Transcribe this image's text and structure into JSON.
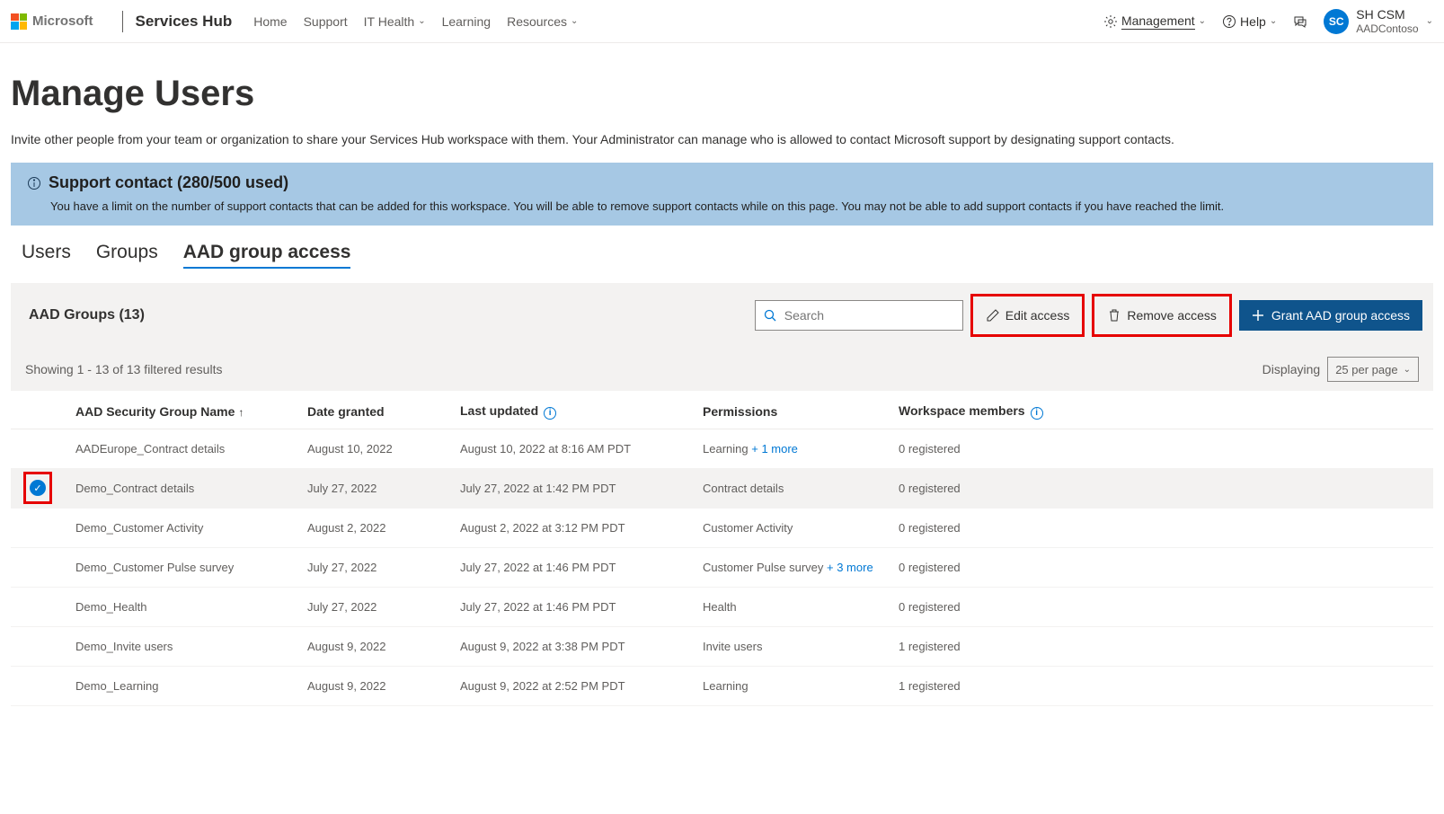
{
  "header": {
    "microsoft": "Microsoft",
    "brand": "Services Hub",
    "nav": [
      "Home",
      "Support",
      "IT Health",
      "Learning",
      "Resources"
    ],
    "management": "Management",
    "help": "Help",
    "user_initials": "SC",
    "user_name": "SH CSM",
    "user_org": "AADContoso"
  },
  "page": {
    "title": "Manage Users",
    "subtitle": "Invite other people from your team or organization to share your Services Hub workspace with them. Your Administrator can manage who is allowed to contact Microsoft support by designating support contacts."
  },
  "banner": {
    "title": "Support contact (280/500 used)",
    "body": "You have a limit on the number of support contacts that can be added for this workspace. You will be able to remove support contacts while on this page. You may not be able to add support contacts if you have reached the limit."
  },
  "tabs": {
    "users": "Users",
    "groups": "Groups",
    "aad": "AAD group access"
  },
  "toolbar": {
    "heading": "AAD Groups (13)",
    "search_placeholder": "Search",
    "edit": "Edit access",
    "remove": "Remove access",
    "grant": "Grant AAD group access"
  },
  "results": {
    "text": "Showing 1 - 13 of 13 filtered results",
    "displaying": "Displaying",
    "perpage": "25 per page"
  },
  "columns": {
    "name": "AAD Security Group Name",
    "date": "Date granted",
    "updated": "Last updated",
    "permissions": "Permissions",
    "members": "Workspace members"
  },
  "rows": [
    {
      "name": "AADEurope_Contract details",
      "date": "August 10, 2022",
      "updated": "August 10, 2022 at 8:16 AM PDT",
      "perm": "Learning",
      "more": "+ 1 more",
      "members": "0 registered"
    },
    {
      "name": "Demo_Contract details",
      "date": "July 27, 2022",
      "updated": "July 27, 2022 at 1:42 PM PDT",
      "perm": "Contract details",
      "more": "",
      "members": "0 registered"
    },
    {
      "name": "Demo_Customer Activity",
      "date": "August 2, 2022",
      "updated": "August 2, 2022 at 3:12 PM PDT",
      "perm": "Customer Activity",
      "more": "",
      "members": "0 registered"
    },
    {
      "name": "Demo_Customer Pulse survey",
      "date": "July 27, 2022",
      "updated": "July 27, 2022 at 1:46 PM PDT",
      "perm": "Customer Pulse survey",
      "more": "+ 3 more",
      "members": "0 registered"
    },
    {
      "name": "Demo_Health",
      "date": "July 27, 2022",
      "updated": "July 27, 2022 at 1:46 PM PDT",
      "perm": "Health",
      "more": "",
      "members": "0 registered"
    },
    {
      "name": "Demo_Invite users",
      "date": "August 9, 2022",
      "updated": "August 9, 2022 at 3:38 PM PDT",
      "perm": "Invite users",
      "more": "",
      "members": "1 registered"
    },
    {
      "name": "Demo_Learning",
      "date": "August 9, 2022",
      "updated": "August 9, 2022 at 2:52 PM PDT",
      "perm": "Learning",
      "more": "",
      "members": "1 registered"
    }
  ]
}
